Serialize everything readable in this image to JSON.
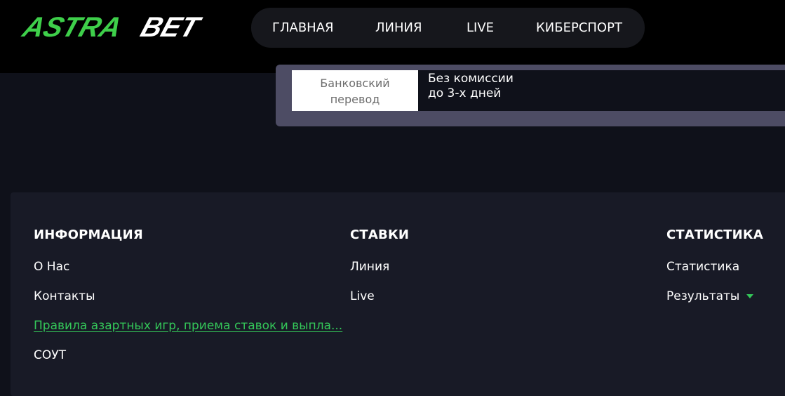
{
  "header": {
    "logo_text_left": "ASTRA",
    "logo_text_right": "BET",
    "logo_colors": {
      "left": "#3ecf4a",
      "right": "#ffffff"
    },
    "nav": [
      {
        "label": "ГЛАВНАЯ"
      },
      {
        "label": "ЛИНИЯ"
      },
      {
        "label": "LIVE"
      },
      {
        "label": "КИБЕРСПОРТ"
      }
    ]
  },
  "payment": {
    "method_label": "Банковский перевод",
    "description_line1": "Без комиссии",
    "description_line2": "до 3-х дней"
  },
  "footer": {
    "columns": [
      {
        "title": "ИНФОРМАЦИЯ",
        "links": [
          {
            "label": "О Нас"
          },
          {
            "label": "Контакты"
          },
          {
            "label": "Правила азартных игр, приема ставок и выпла..."
          },
          {
            "label": "СОУТ"
          }
        ]
      },
      {
        "title": "СТАВКИ",
        "links": [
          {
            "label": "Линия"
          },
          {
            "label": "Live"
          }
        ]
      },
      {
        "title": "СТАТИСТИКА",
        "links": [
          {
            "label": "Статистика"
          },
          {
            "label": "Результаты"
          }
        ]
      }
    ]
  },
  "colors": {
    "accent_green": "#34c759",
    "background": "#0f111a",
    "footer_bg": "#181a26",
    "panel_bg": "#4d4c64"
  },
  "icons": {
    "dropdown": "caret-down-icon"
  }
}
